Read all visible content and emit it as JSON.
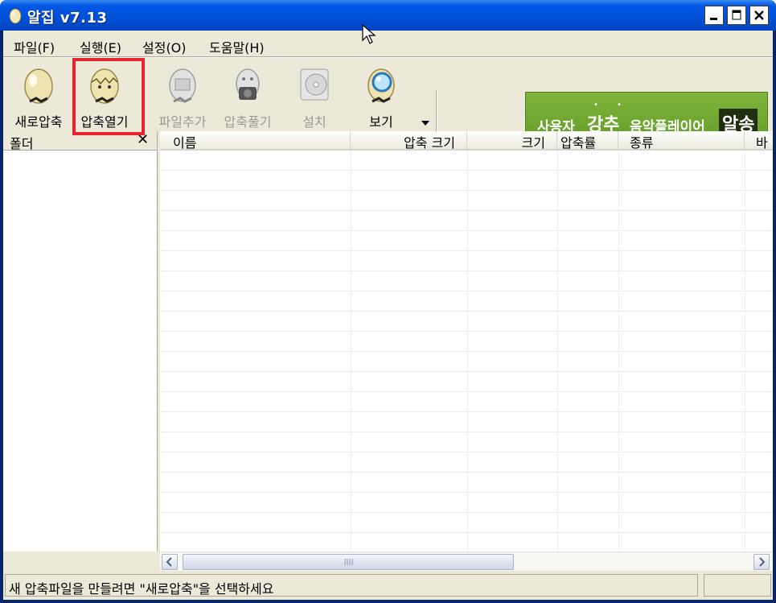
{
  "window": {
    "title": "알집 v7.13"
  },
  "menu": [
    {
      "label": "파일(F)"
    },
    {
      "label": "실행(E)"
    },
    {
      "label": "설정(O)"
    },
    {
      "label": "도움말(H)"
    }
  ],
  "toolbar": {
    "items": [
      {
        "label": "새로압축",
        "icon": "egg-icon",
        "enabled": true
      },
      {
        "label": "압축열기",
        "icon": "cracked-egg-icon",
        "enabled": true
      },
      {
        "label": "파일추가",
        "icon": "add-file-icon",
        "enabled": false
      },
      {
        "label": "압축풀기",
        "icon": "extract-icon",
        "enabled": false
      },
      {
        "label": "설치",
        "icon": "install-cd-icon",
        "enabled": false
      },
      {
        "label": "보기",
        "icon": "view-magnifier-icon",
        "enabled": true
      }
    ]
  },
  "banner": {
    "part1": "사용자",
    "part2": "강추",
    "part3": "음악플레이어",
    "part4": "알송"
  },
  "folder_pane": {
    "title": "폴더"
  },
  "columns": [
    {
      "label": "이름"
    },
    {
      "label": "압축 크기"
    },
    {
      "label": "크기"
    },
    {
      "label": "압축률"
    },
    {
      "label": "종류"
    },
    {
      "label": "바"
    }
  ],
  "status": {
    "text": "새 압축파일을 만들려면 \"새로압축\"을 선택하세요"
  },
  "colors": {
    "titlebar": "#0054E3",
    "highlight": "#E8232B",
    "banner": "#6FA830"
  }
}
